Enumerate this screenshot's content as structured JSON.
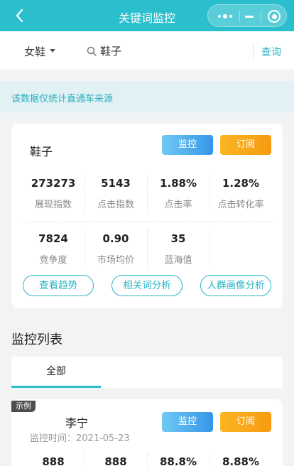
{
  "nav": {
    "title": "关键词监控",
    "colors": {
      "bar": "#2bbfcd"
    }
  },
  "search": {
    "category": "女鞋",
    "keyword": "鞋子",
    "query_label": "查询"
  },
  "notice": "该数据仅统计直通车来源",
  "summary": {
    "keyword": "鞋子",
    "monitor_label": "监控",
    "subscribe_label": "订阅",
    "stats": [
      {
        "value": "273273",
        "label": "展现指数"
      },
      {
        "value": "5143",
        "label": "点击指数"
      },
      {
        "value": "1.88%",
        "label": "点击率"
      },
      {
        "value": "1.28%",
        "label": "点击转化率"
      },
      {
        "value": "7824",
        "label": "竞争度"
      },
      {
        "value": "0.90",
        "label": "市场均价"
      },
      {
        "value": "35",
        "label": "蓝海值"
      }
    ],
    "actions": [
      "查看趋势",
      "相关词分析",
      "人群画像分析"
    ]
  },
  "monitor_list": {
    "title": "监控列表",
    "tabs": [
      {
        "label": "全部",
        "active": true
      }
    ],
    "items": [
      {
        "tag": "示例",
        "name": "李宁",
        "time": "监控时间：2021-05-23",
        "monitor_label": "监控",
        "subscribe_label": "订阅",
        "stats": [
          "888",
          "888",
          "88.8%",
          "8.88%"
        ]
      }
    ]
  },
  "colors": {
    "accent": "#2bbfcd",
    "link": "#2bb4c4",
    "monitor_gradient": [
      "#6fc9f2",
      "#3596e8"
    ],
    "subscribe_gradient": [
      "#fbb623",
      "#f79a12"
    ]
  }
}
